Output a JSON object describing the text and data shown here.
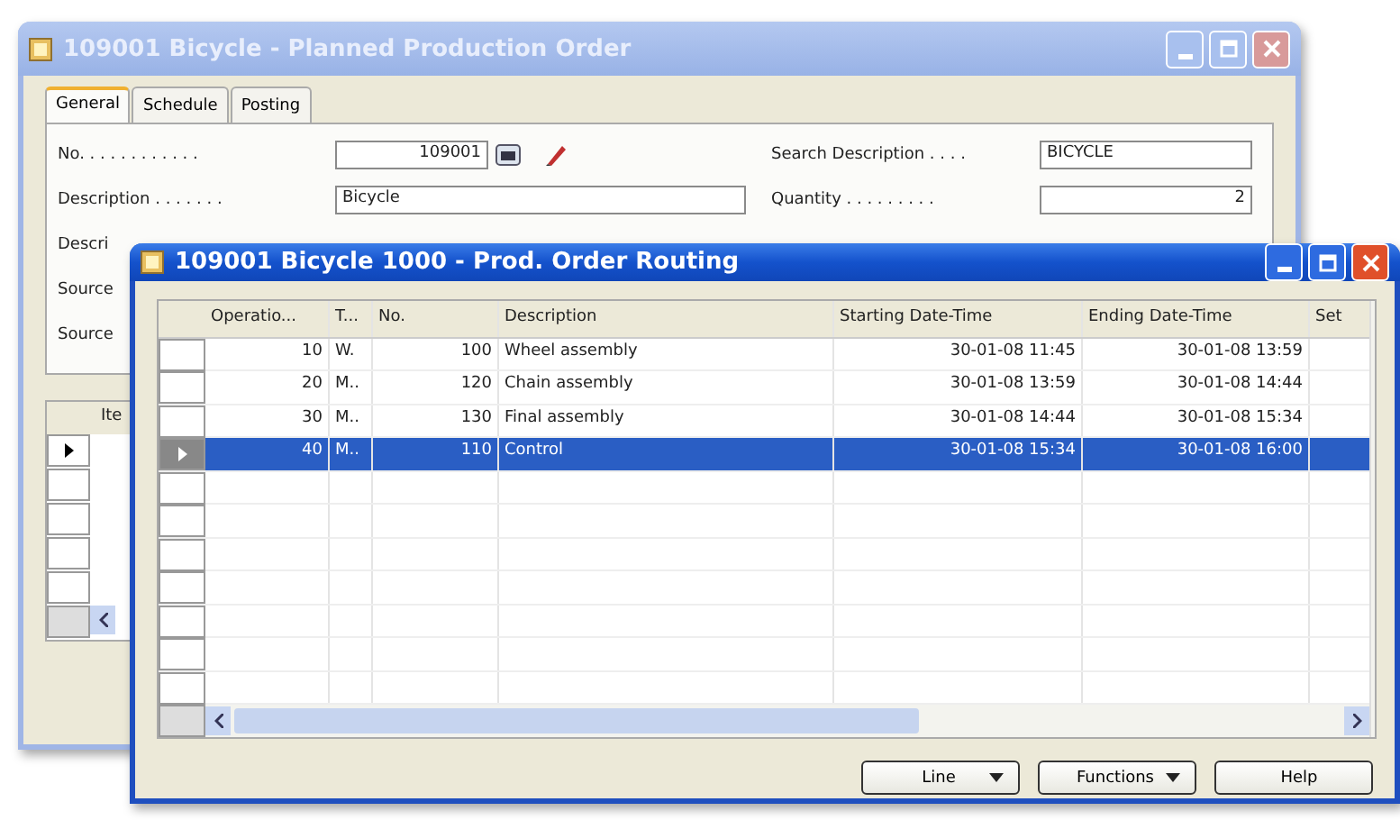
{
  "order_window": {
    "title": "109001 Bicycle - Planned Production Order",
    "tabs": [
      {
        "label": "General",
        "selected": true
      },
      {
        "label": "Schedule",
        "selected": false
      },
      {
        "label": "Posting",
        "selected": false
      }
    ],
    "left_fields": [
      {
        "label": "No. . . . . . . . . . . .",
        "value": "109001",
        "kind": "number"
      },
      {
        "label": "Description . . . . . . .",
        "value": "Bicycle",
        "kind": "text"
      }
    ],
    "covered_labels": [
      "Descri",
      "Source",
      "Source"
    ],
    "right_fields": [
      {
        "label": "Search Description . . . .",
        "value": "BICYCLE",
        "kind": "text"
      },
      {
        "label": "Quantity . . . . . . . . .",
        "value": "2",
        "kind": "number"
      }
    ],
    "lines": {
      "column_1": "Ite",
      "rows": [
        {
          "selected": true
        },
        {
          "selected": false
        },
        {
          "selected": false
        },
        {
          "selected": false
        },
        {
          "selected": false
        }
      ]
    }
  },
  "routing_window": {
    "title": "109001 Bicycle 1000 - Prod. Order Routing",
    "columns": [
      "Operatio...",
      "T...",
      "No.",
      "Description",
      "Starting Date-Time",
      "Ending Date-Time",
      "Set"
    ],
    "rows": [
      {
        "cells": [
          "10",
          "W.",
          "100",
          "Wheel assembly",
          "30-01-08 11:45",
          "30-01-08 13:59"
        ],
        "selected": false
      },
      {
        "cells": [
          "20",
          "M..",
          "120",
          "Chain assembly",
          "30-01-08 13:59",
          "30-01-08 14:44"
        ],
        "selected": false
      },
      {
        "cells": [
          "30",
          "M..",
          "130",
          "Final assembly",
          "30-01-08 14:44",
          "30-01-08 15:34"
        ],
        "selected": false
      },
      {
        "cells": [
          "40",
          "M..",
          "110",
          "Control",
          "30-01-08 15:34",
          "30-01-08 16:00"
        ],
        "selected": true
      }
    ],
    "buttons": [
      {
        "label": "Line",
        "kind": "menu"
      },
      {
        "label": "Functions",
        "kind": "menu"
      },
      {
        "label": "Help",
        "kind": "plain"
      }
    ]
  }
}
